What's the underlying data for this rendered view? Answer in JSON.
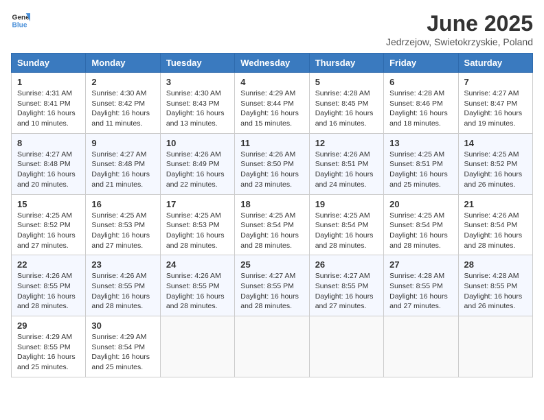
{
  "header": {
    "logo_general": "General",
    "logo_blue": "Blue",
    "title": "June 2025",
    "subtitle": "Jedrzejow, Swietokrzyskie, Poland"
  },
  "columns": [
    "Sunday",
    "Monday",
    "Tuesday",
    "Wednesday",
    "Thursday",
    "Friday",
    "Saturday"
  ],
  "weeks": [
    [
      {
        "day": "1",
        "sunrise": "4:31 AM",
        "sunset": "8:41 PM",
        "daylight": "16 hours and 10 minutes."
      },
      {
        "day": "2",
        "sunrise": "4:30 AM",
        "sunset": "8:42 PM",
        "daylight": "16 hours and 11 minutes."
      },
      {
        "day": "3",
        "sunrise": "4:30 AM",
        "sunset": "8:43 PM",
        "daylight": "16 hours and 13 minutes."
      },
      {
        "day": "4",
        "sunrise": "4:29 AM",
        "sunset": "8:44 PM",
        "daylight": "16 hours and 15 minutes."
      },
      {
        "day": "5",
        "sunrise": "4:28 AM",
        "sunset": "8:45 PM",
        "daylight": "16 hours and 16 minutes."
      },
      {
        "day": "6",
        "sunrise": "4:28 AM",
        "sunset": "8:46 PM",
        "daylight": "16 hours and 18 minutes."
      },
      {
        "day": "7",
        "sunrise": "4:27 AM",
        "sunset": "8:47 PM",
        "daylight": "16 hours and 19 minutes."
      }
    ],
    [
      {
        "day": "8",
        "sunrise": "4:27 AM",
        "sunset": "8:48 PM",
        "daylight": "16 hours and 20 minutes."
      },
      {
        "day": "9",
        "sunrise": "4:27 AM",
        "sunset": "8:48 PM",
        "daylight": "16 hours and 21 minutes."
      },
      {
        "day": "10",
        "sunrise": "4:26 AM",
        "sunset": "8:49 PM",
        "daylight": "16 hours and 22 minutes."
      },
      {
        "day": "11",
        "sunrise": "4:26 AM",
        "sunset": "8:50 PM",
        "daylight": "16 hours and 23 minutes."
      },
      {
        "day": "12",
        "sunrise": "4:26 AM",
        "sunset": "8:51 PM",
        "daylight": "16 hours and 24 minutes."
      },
      {
        "day": "13",
        "sunrise": "4:25 AM",
        "sunset": "8:51 PM",
        "daylight": "16 hours and 25 minutes."
      },
      {
        "day": "14",
        "sunrise": "4:25 AM",
        "sunset": "8:52 PM",
        "daylight": "16 hours and 26 minutes."
      }
    ],
    [
      {
        "day": "15",
        "sunrise": "4:25 AM",
        "sunset": "8:52 PM",
        "daylight": "16 hours and 27 minutes."
      },
      {
        "day": "16",
        "sunrise": "4:25 AM",
        "sunset": "8:53 PM",
        "daylight": "16 hours and 27 minutes."
      },
      {
        "day": "17",
        "sunrise": "4:25 AM",
        "sunset": "8:53 PM",
        "daylight": "16 hours and 28 minutes."
      },
      {
        "day": "18",
        "sunrise": "4:25 AM",
        "sunset": "8:54 PM",
        "daylight": "16 hours and 28 minutes."
      },
      {
        "day": "19",
        "sunrise": "4:25 AM",
        "sunset": "8:54 PM",
        "daylight": "16 hours and 28 minutes."
      },
      {
        "day": "20",
        "sunrise": "4:25 AM",
        "sunset": "8:54 PM",
        "daylight": "16 hours and 28 minutes."
      },
      {
        "day": "21",
        "sunrise": "4:26 AM",
        "sunset": "8:54 PM",
        "daylight": "16 hours and 28 minutes."
      }
    ],
    [
      {
        "day": "22",
        "sunrise": "4:26 AM",
        "sunset": "8:55 PM",
        "daylight": "16 hours and 28 minutes."
      },
      {
        "day": "23",
        "sunrise": "4:26 AM",
        "sunset": "8:55 PM",
        "daylight": "16 hours and 28 minutes."
      },
      {
        "day": "24",
        "sunrise": "4:26 AM",
        "sunset": "8:55 PM",
        "daylight": "16 hours and 28 minutes."
      },
      {
        "day": "25",
        "sunrise": "4:27 AM",
        "sunset": "8:55 PM",
        "daylight": "16 hours and 28 minutes."
      },
      {
        "day": "26",
        "sunrise": "4:27 AM",
        "sunset": "8:55 PM",
        "daylight": "16 hours and 27 minutes."
      },
      {
        "day": "27",
        "sunrise": "4:28 AM",
        "sunset": "8:55 PM",
        "daylight": "16 hours and 27 minutes."
      },
      {
        "day": "28",
        "sunrise": "4:28 AM",
        "sunset": "8:55 PM",
        "daylight": "16 hours and 26 minutes."
      }
    ],
    [
      {
        "day": "29",
        "sunrise": "4:29 AM",
        "sunset": "8:55 PM",
        "daylight": "16 hours and 25 minutes."
      },
      {
        "day": "30",
        "sunrise": "4:29 AM",
        "sunset": "8:54 PM",
        "daylight": "16 hours and 25 minutes."
      },
      null,
      null,
      null,
      null,
      null
    ]
  ]
}
